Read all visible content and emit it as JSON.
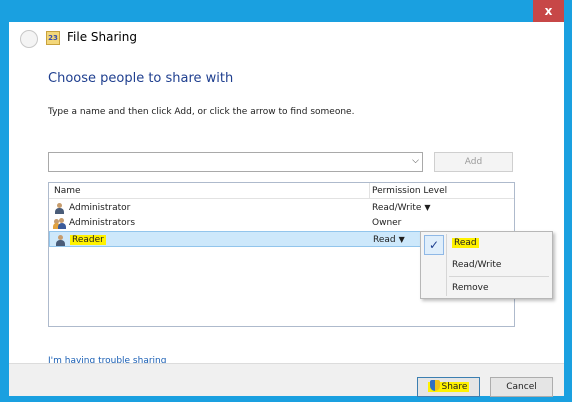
{
  "window": {
    "title": "File Sharing",
    "close_label": "x",
    "icon_glyph": "23"
  },
  "main": {
    "heading": "Choose people to share with",
    "instruction": "Type a name and then click Add, or click the arrow to find someone.",
    "name_input_value": "",
    "add_label": "Add",
    "trouble_link": "I'm having trouble sharing"
  },
  "table": {
    "columns": [
      "Name",
      "Permission Level"
    ],
    "rows": [
      {
        "name": "Administrator",
        "permission": "Read/Write",
        "icon": "user-icon",
        "has_dropdown": true
      },
      {
        "name": "Administrators",
        "permission": "Owner",
        "icon": "group-icon",
        "has_dropdown": false
      },
      {
        "name": "Reader",
        "permission": "Read",
        "icon": "user-icon",
        "has_dropdown": true,
        "selected": true
      }
    ]
  },
  "context_menu": {
    "items": [
      "Read",
      "Read/Write",
      "Remove"
    ],
    "checked": "Read"
  },
  "footer": {
    "share_label": "Share",
    "cancel_label": "Cancel"
  },
  "colors": {
    "frame": "#1aa0e0",
    "heading": "#1f3f8f",
    "highlight": "#fff200",
    "selection": "#cde8fb"
  }
}
